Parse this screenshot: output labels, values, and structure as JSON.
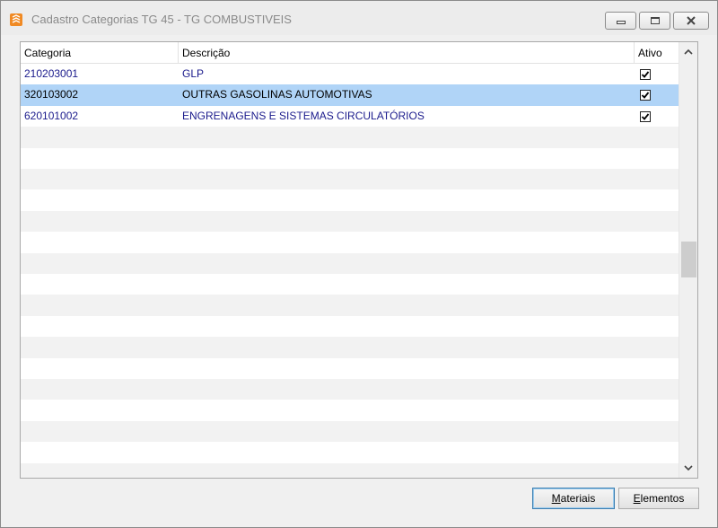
{
  "window": {
    "title": "Cadastro Categorias TG 45 - TG COMBUSTIVEIS",
    "icon": "app-icon",
    "controls": [
      "minimize-icon",
      "maximize-icon",
      "close-icon"
    ]
  },
  "table": {
    "columns": [
      {
        "key": "categoria",
        "label": "Categoria"
      },
      {
        "key": "descricao",
        "label": "Descrição"
      },
      {
        "key": "ativo",
        "label": "Ativo"
      }
    ],
    "rows": [
      {
        "categoria": "210203001",
        "descricao": "GLP",
        "ativo": true,
        "selected": false
      },
      {
        "categoria": "320103002",
        "descricao": "OUTRAS GASOLINAS AUTOMOTIVAS",
        "ativo": true,
        "selected": true
      },
      {
        "categoria": "620101002",
        "descricao": "ENGRENAGENS E SISTEMAS CIRCULATÓRIOS",
        "ativo": true,
        "selected": false
      }
    ],
    "empty_row_count": 17,
    "colors": {
      "text": "#1b1b8c",
      "selected_row": "#b0d4f7",
      "alt_row": "#f2f2f2"
    }
  },
  "buttons": {
    "materiais": {
      "mnemonic": "M",
      "rest": "ateriais"
    },
    "elementos": {
      "mnemonic": "E",
      "rest": "lementos"
    }
  }
}
